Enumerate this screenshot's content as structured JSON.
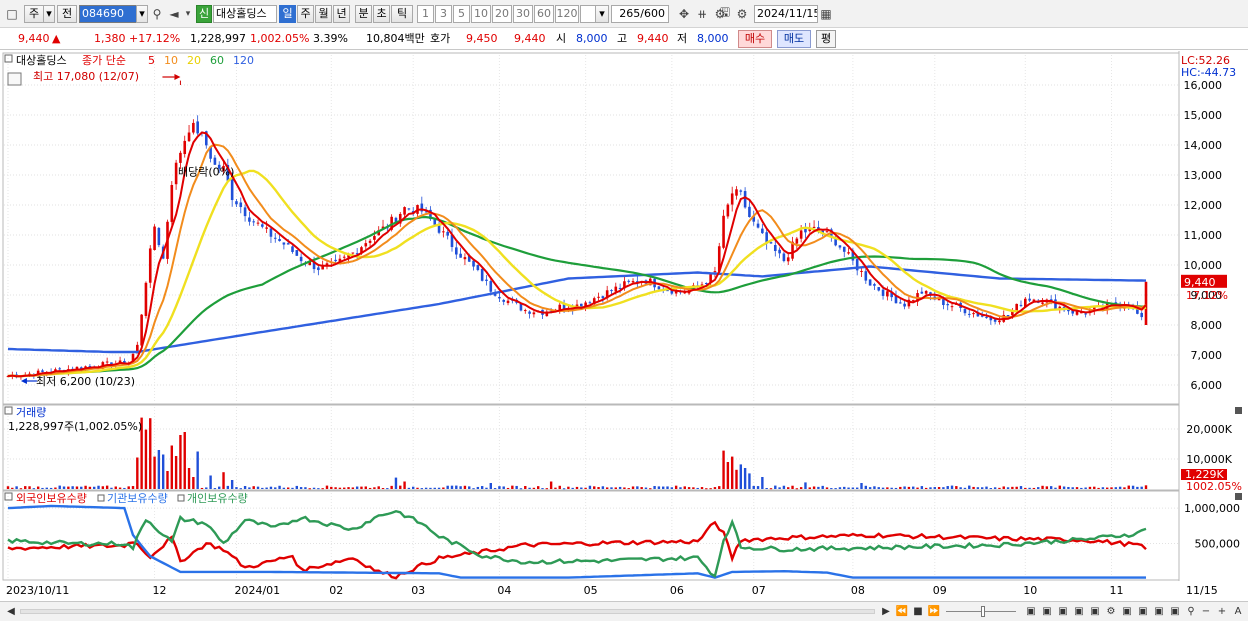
{
  "toolbar": {
    "period": "주",
    "prev": "전",
    "code": "084690",
    "badge": "신",
    "name": "대상홀딩스",
    "intervals": [
      "일",
      "주",
      "월",
      "년",
      "분",
      "초",
      "틱"
    ],
    "interval_selected": "일",
    "counts": [
      "1",
      "3",
      "5",
      "10",
      "20",
      "30",
      "60",
      "120"
    ],
    "range": "265/600",
    "date": "2024/11/15"
  },
  "quote": {
    "price": "9,440",
    "change_arrow": "▲",
    "change": "1,380",
    "change_pct": "+17.12%",
    "volume": "1,228,997",
    "volume_pct": "1,002.05%",
    "turnover_pct": "3.39%",
    "amount": "10,804백만",
    "hoga_label": "호가",
    "hoga_ask": "9,450",
    "hoga_bid": "9,440",
    "open_label": "시",
    "open": "8,000",
    "high_label": "고",
    "high": "9,440",
    "low_label": "저",
    "low": "8,000",
    "buy": "매수",
    "sell": "매도",
    "eval": "평"
  },
  "colors": {
    "up": "#e00000",
    "down": "#1f4fd8",
    "ma5": "#e00000",
    "ma10": "#f28c1c",
    "ma20": "#f0e020",
    "ma60": "#1e9e3a",
    "ma120": "#3060e0",
    "foreign": "#e00000",
    "institution": "#2a72e8",
    "individual": "#2e9a56"
  },
  "chart_data": [
    {
      "type": "candlestick",
      "title": "대상홀딩스",
      "legend": {
        "prefix": "종가 단순",
        "items": [
          {
            "label": "5",
            "color": "#e00000"
          },
          {
            "label": "10",
            "color": "#f28c1c"
          },
          {
            "label": "20",
            "color": "#e8d000"
          },
          {
            "label": "60",
            "color": "#1e9e3a"
          },
          {
            "label": "120",
            "color": "#3060e0"
          }
        ]
      },
      "right_labels": {
        "lc": "LC:52.26",
        "hc": "HC:-44.73"
      },
      "ylim": [
        5400,
        17000
      ],
      "yticks": [
        {
          "v": 16000,
          "label": "16,000"
        },
        {
          "v": 15000,
          "label": "15,000"
        },
        {
          "v": 14000,
          "label": "14,000"
        },
        {
          "v": 13000,
          "label": "13,000"
        },
        {
          "v": 12000,
          "label": "12,000"
        },
        {
          "v": 11000,
          "label": "11,000"
        },
        {
          "v": 10000,
          "label": "10,000"
        },
        {
          "v": 9000,
          "label": "9,000"
        },
        {
          "v": 8000,
          "label": "8,000"
        },
        {
          "v": 7000,
          "label": "7,000"
        },
        {
          "v": 6000,
          "label": "6,000"
        }
      ],
      "annotations": {
        "high": "최고 17,080 (12/07)",
        "low": "최저 6,200 (10/23)",
        "dividend": "배당락(0%)"
      },
      "last_price_label": "9,440",
      "last_pct_label": "17.12%",
      "anchors": [
        [
          0,
          6300
        ],
        [
          10,
          6450
        ],
        [
          20,
          6650
        ],
        [
          28,
          6750
        ],
        [
          30,
          7300
        ],
        [
          32,
          9500
        ],
        [
          34,
          11300
        ],
        [
          36,
          10200
        ],
        [
          38,
          12800
        ],
        [
          40,
          13800
        ],
        [
          42,
          14600
        ],
        [
          44,
          14500
        ],
        [
          46,
          14000
        ],
        [
          48,
          13300
        ],
        [
          50,
          13200
        ],
        [
          52,
          12300
        ],
        [
          56,
          11600
        ],
        [
          60,
          11100
        ],
        [
          64,
          10700
        ],
        [
          68,
          10200
        ],
        [
          72,
          9900
        ],
        [
          76,
          10000
        ],
        [
          80,
          10400
        ],
        [
          84,
          10900
        ],
        [
          88,
          11300
        ],
        [
          92,
          11900
        ],
        [
          96,
          11800
        ],
        [
          100,
          11200
        ],
        [
          104,
          10500
        ],
        [
          108,
          9900
        ],
        [
          112,
          9200
        ],
        [
          116,
          8800
        ],
        [
          120,
          8500
        ],
        [
          124,
          8450
        ],
        [
          128,
          8600
        ],
        [
          132,
          8650
        ],
        [
          136,
          8900
        ],
        [
          140,
          9150
        ],
        [
          144,
          9400
        ],
        [
          148,
          9500
        ],
        [
          152,
          9250
        ],
        [
          156,
          9100
        ],
        [
          160,
          9250
        ],
        [
          164,
          9750
        ],
        [
          166,
          11500
        ],
        [
          168,
          12400
        ],
        [
          170,
          12300
        ],
        [
          172,
          11600
        ],
        [
          176,
          10700
        ],
        [
          180,
          10150
        ],
        [
          184,
          11100
        ],
        [
          188,
          11200
        ],
        [
          192,
          10800
        ],
        [
          196,
          10100
        ],
        [
          200,
          9400
        ],
        [
          204,
          9000
        ],
        [
          208,
          8700
        ],
        [
          212,
          9100
        ],
        [
          216,
          8800
        ],
        [
          220,
          8600
        ],
        [
          224,
          8400
        ],
        [
          228,
          8200
        ],
        [
          232,
          8300
        ],
        [
          236,
          8900
        ],
        [
          240,
          8850
        ],
        [
          244,
          8600
        ],
        [
          248,
          8400
        ],
        [
          252,
          8500
        ],
        [
          256,
          8650
        ],
        [
          260,
          8750
        ],
        [
          263,
          8150
        ],
        [
          264,
          8050
        ]
      ],
      "last_candle": {
        "open": 8000,
        "high": 9440,
        "low": 8000,
        "close": 9440
      },
      "period_high": 17080,
      "period_low": 6200,
      "ma120_anchors": [
        [
          0,
          7200
        ],
        [
          24,
          7100
        ],
        [
          30,
          7100
        ],
        [
          56,
          7700
        ],
        [
          100,
          8700
        ],
        [
          130,
          9550
        ],
        [
          160,
          9750
        ],
        [
          175,
          9620
        ],
        [
          200,
          9950
        ],
        [
          230,
          9550
        ],
        [
          264,
          9480
        ]
      ]
    },
    {
      "type": "bar",
      "title": "거래량",
      "label": "1,228,997주(1,002.05%)",
      "ylim": [
        0,
        24000
      ],
      "yticks": [
        {
          "v": 20000,
          "label": "20,000K"
        },
        {
          "v": 10000,
          "label": "10,000K"
        }
      ],
      "last_label": "1,229K",
      "last_pct_label": "1002.05%",
      "spikes": [
        [
          30,
          10500
        ],
        [
          31,
          23800
        ],
        [
          32,
          19800
        ],
        [
          33,
          23600
        ],
        [
          34,
          10800
        ],
        [
          35,
          13000
        ],
        [
          36,
          11500
        ],
        [
          37,
          6000
        ],
        [
          38,
          14500
        ],
        [
          39,
          11000
        ],
        [
          40,
          18000
        ],
        [
          41,
          19000
        ],
        [
          42,
          7000
        ],
        [
          43,
          4000
        ],
        [
          44,
          12500
        ],
        [
          47,
          4500
        ],
        [
          50,
          5600
        ],
        [
          52,
          3000
        ],
        [
          90,
          3800
        ],
        [
          92,
          2500
        ],
        [
          112,
          2000
        ],
        [
          126,
          2500
        ],
        [
          166,
          12800
        ],
        [
          167,
          9000
        ],
        [
          168,
          10800
        ],
        [
          169,
          6400
        ],
        [
          170,
          8200
        ],
        [
          171,
          7000
        ],
        [
          172,
          5200
        ],
        [
          175,
          4000
        ],
        [
          185,
          2200
        ],
        [
          198,
          2000
        ],
        [
          264,
          1229
        ]
      ]
    },
    {
      "type": "line",
      "legend": [
        "외국인보유수량",
        "기관보유수량",
        "개인보유수량"
      ],
      "ylim": [
        0,
        1100000
      ],
      "yticks": [
        {
          "v": 1000000,
          "label": "1,000,000"
        },
        {
          "v": 500000,
          "label": "500,000"
        }
      ],
      "series": [
        {
          "name": "외국인보유수량",
          "anchors": [
            [
              0,
              430000
            ],
            [
              15,
              460000
            ],
            [
              27,
              470000
            ],
            [
              29,
              540000
            ],
            [
              33,
              320000
            ],
            [
              38,
              580000
            ],
            [
              40,
              250000
            ],
            [
              46,
              500000
            ],
            [
              50,
              420000
            ],
            [
              55,
              160000
            ],
            [
              60,
              230000
            ],
            [
              66,
              330000
            ],
            [
              68,
              120000
            ],
            [
              74,
              210000
            ],
            [
              80,
              300000
            ],
            [
              86,
              100000
            ],
            [
              90,
              40000
            ],
            [
              95,
              170000
            ],
            [
              100,
              290000
            ],
            [
              110,
              380000
            ],
            [
              120,
              480000
            ],
            [
              140,
              510000
            ],
            [
              160,
              530000
            ],
            [
              164,
              800000
            ],
            [
              166,
              640000
            ],
            [
              168,
              300000
            ],
            [
              170,
              550000
            ],
            [
              180,
              580000
            ],
            [
              200,
              620000
            ],
            [
              230,
              570000
            ],
            [
              250,
              550000
            ],
            [
              262,
              480000
            ],
            [
              264,
              420000
            ]
          ]
        },
        {
          "name": "기관보유수량",
          "anchors": [
            [
              0,
              1000000
            ],
            [
              10,
              1030000
            ],
            [
              27,
              1000000
            ],
            [
              29,
              620000
            ],
            [
              33,
              320000
            ],
            [
              40,
              100000
            ],
            [
              60,
              100000
            ],
            [
              100,
              80000
            ],
            [
              105,
              20000
            ],
            [
              130,
              20000
            ],
            [
              160,
              80000
            ],
            [
              164,
              20000
            ],
            [
              168,
              100000
            ],
            [
              180,
              110000
            ],
            [
              190,
              90000
            ],
            [
              196,
              20000
            ],
            [
              264,
              20000
            ]
          ]
        },
        {
          "name": "개인보유수량",
          "anchors": [
            [
              0,
              540000
            ],
            [
              15,
              500000
            ],
            [
              27,
              500000
            ],
            [
              29,
              440000
            ],
            [
              32,
              850000
            ],
            [
              38,
              520000
            ],
            [
              40,
              850000
            ],
            [
              46,
              780000
            ],
            [
              50,
              500000
            ],
            [
              55,
              830000
            ],
            [
              62,
              720000
            ],
            [
              68,
              870000
            ],
            [
              74,
              780000
            ],
            [
              80,
              700000
            ],
            [
              86,
              890000
            ],
            [
              90,
              960000
            ],
            [
              96,
              780000
            ],
            [
              100,
              600000
            ],
            [
              110,
              330000
            ],
            [
              120,
              240000
            ],
            [
              140,
              260000
            ],
            [
              160,
              300000
            ],
            [
              164,
              40000
            ],
            [
              166,
              560000
            ],
            [
              168,
              790000
            ],
            [
              170,
              450000
            ],
            [
              180,
              420000
            ],
            [
              200,
              440000
            ],
            [
              230,
              480000
            ],
            [
              250,
              560000
            ],
            [
              262,
              640000
            ],
            [
              264,
              730000
            ]
          ]
        }
      ]
    }
  ],
  "x_axis": {
    "labels": [
      {
        "i": 0,
        "label": "2023/10/11"
      },
      {
        "i": 34,
        "label": "12"
      },
      {
        "i": 53,
        "label": "2024/01"
      },
      {
        "i": 75,
        "label": "02"
      },
      {
        "i": 94,
        "label": "03"
      },
      {
        "i": 114,
        "label": "04"
      },
      {
        "i": 134,
        "label": "05"
      },
      {
        "i": 154,
        "label": "06"
      },
      {
        "i": 173,
        "label": "07"
      },
      {
        "i": 196,
        "label": "08"
      },
      {
        "i": 215,
        "label": "09"
      },
      {
        "i": 236,
        "label": "10"
      },
      {
        "i": 256,
        "label": "11"
      }
    ],
    "last": "11/15"
  },
  "bottom": {
    "plus": "+",
    "a": "A",
    "minus": "−"
  }
}
